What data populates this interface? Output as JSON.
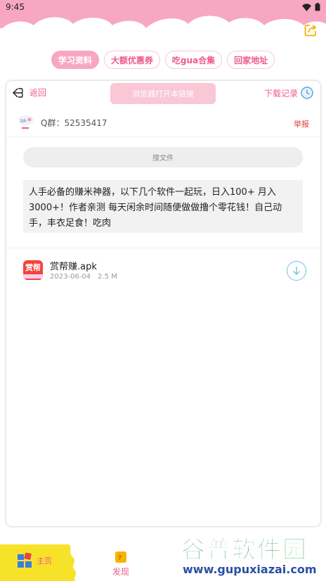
{
  "status": {
    "time": "9:45"
  },
  "tabs": [
    {
      "label": "学习资料",
      "active": true
    },
    {
      "label": "大额优惠券",
      "active": false
    },
    {
      "label": "吃gua合集",
      "active": false
    },
    {
      "label": "回家地址",
      "active": false
    }
  ],
  "toolbar": {
    "back_label": "返回",
    "open_browser_label": "浏览器打开本链接",
    "records_label": "下载记录"
  },
  "group": {
    "text": "Q群：52535417",
    "report_label": "举报"
  },
  "search": {
    "placeholder": "搜文件"
  },
  "description": "人手必备的赚米神器，以下几个软件一起玩，日入100+ 月入3000+！作者亲测 每天闲余时间随便做做撸个零花钱！自己动手，丰衣足食！吃肉",
  "files": [
    {
      "name": "赏帮赚.apk",
      "date": "2023-06-04",
      "size": "2.5 M",
      "icon_text": "赏帮"
    }
  ],
  "nav": {
    "home_label": "主页",
    "discover_label": "发现"
  },
  "watermark": {
    "title": "谷普软件园",
    "url": "www.gupuxiazai.com"
  },
  "colors": {
    "accent_pink": "#ef5a8f",
    "header_pink": "#f7a7c2",
    "download_blue": "#6fc4ea",
    "report_red": "#e53935"
  }
}
